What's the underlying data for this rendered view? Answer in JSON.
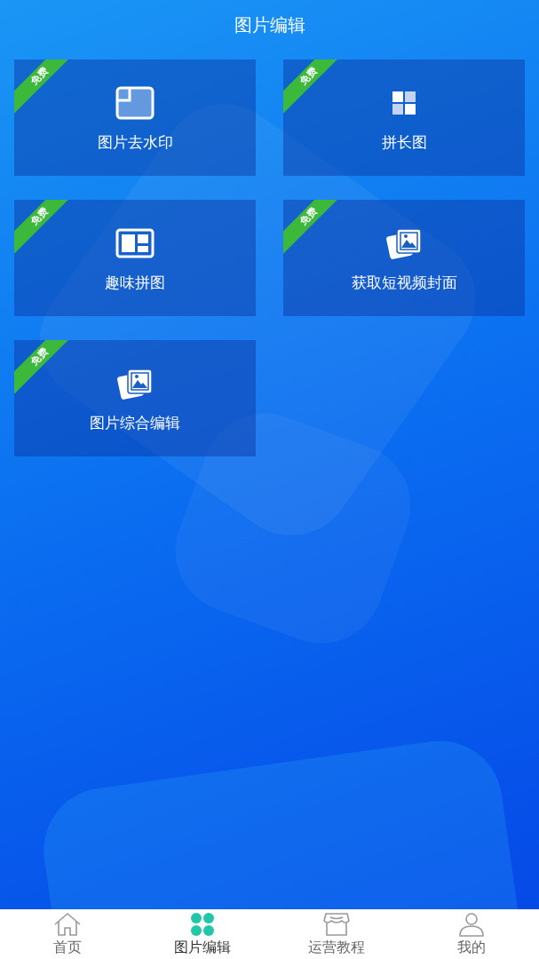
{
  "header": {
    "title": "图片编辑"
  },
  "tiles": [
    {
      "label": "图片去水印",
      "badge": "免费",
      "kind": "watermark"
    },
    {
      "label": "拼长图",
      "badge": "免费",
      "kind": "grid"
    },
    {
      "label": "趣味拼图",
      "badge": "免费",
      "kind": "collage"
    },
    {
      "label": "获取短视频封面",
      "badge": "免费",
      "kind": "photos"
    },
    {
      "label": "图片综合编辑",
      "badge": "免费",
      "kind": "photos"
    }
  ],
  "tab_bar": [
    {
      "label": "首页",
      "kind": "home",
      "selected": false
    },
    {
      "label": "图片编辑",
      "kind": "clover",
      "selected": true
    },
    {
      "label": "运营教程",
      "kind": "shop",
      "selected": false
    },
    {
      "label": "我的",
      "kind": "user",
      "selected": false
    }
  ]
}
